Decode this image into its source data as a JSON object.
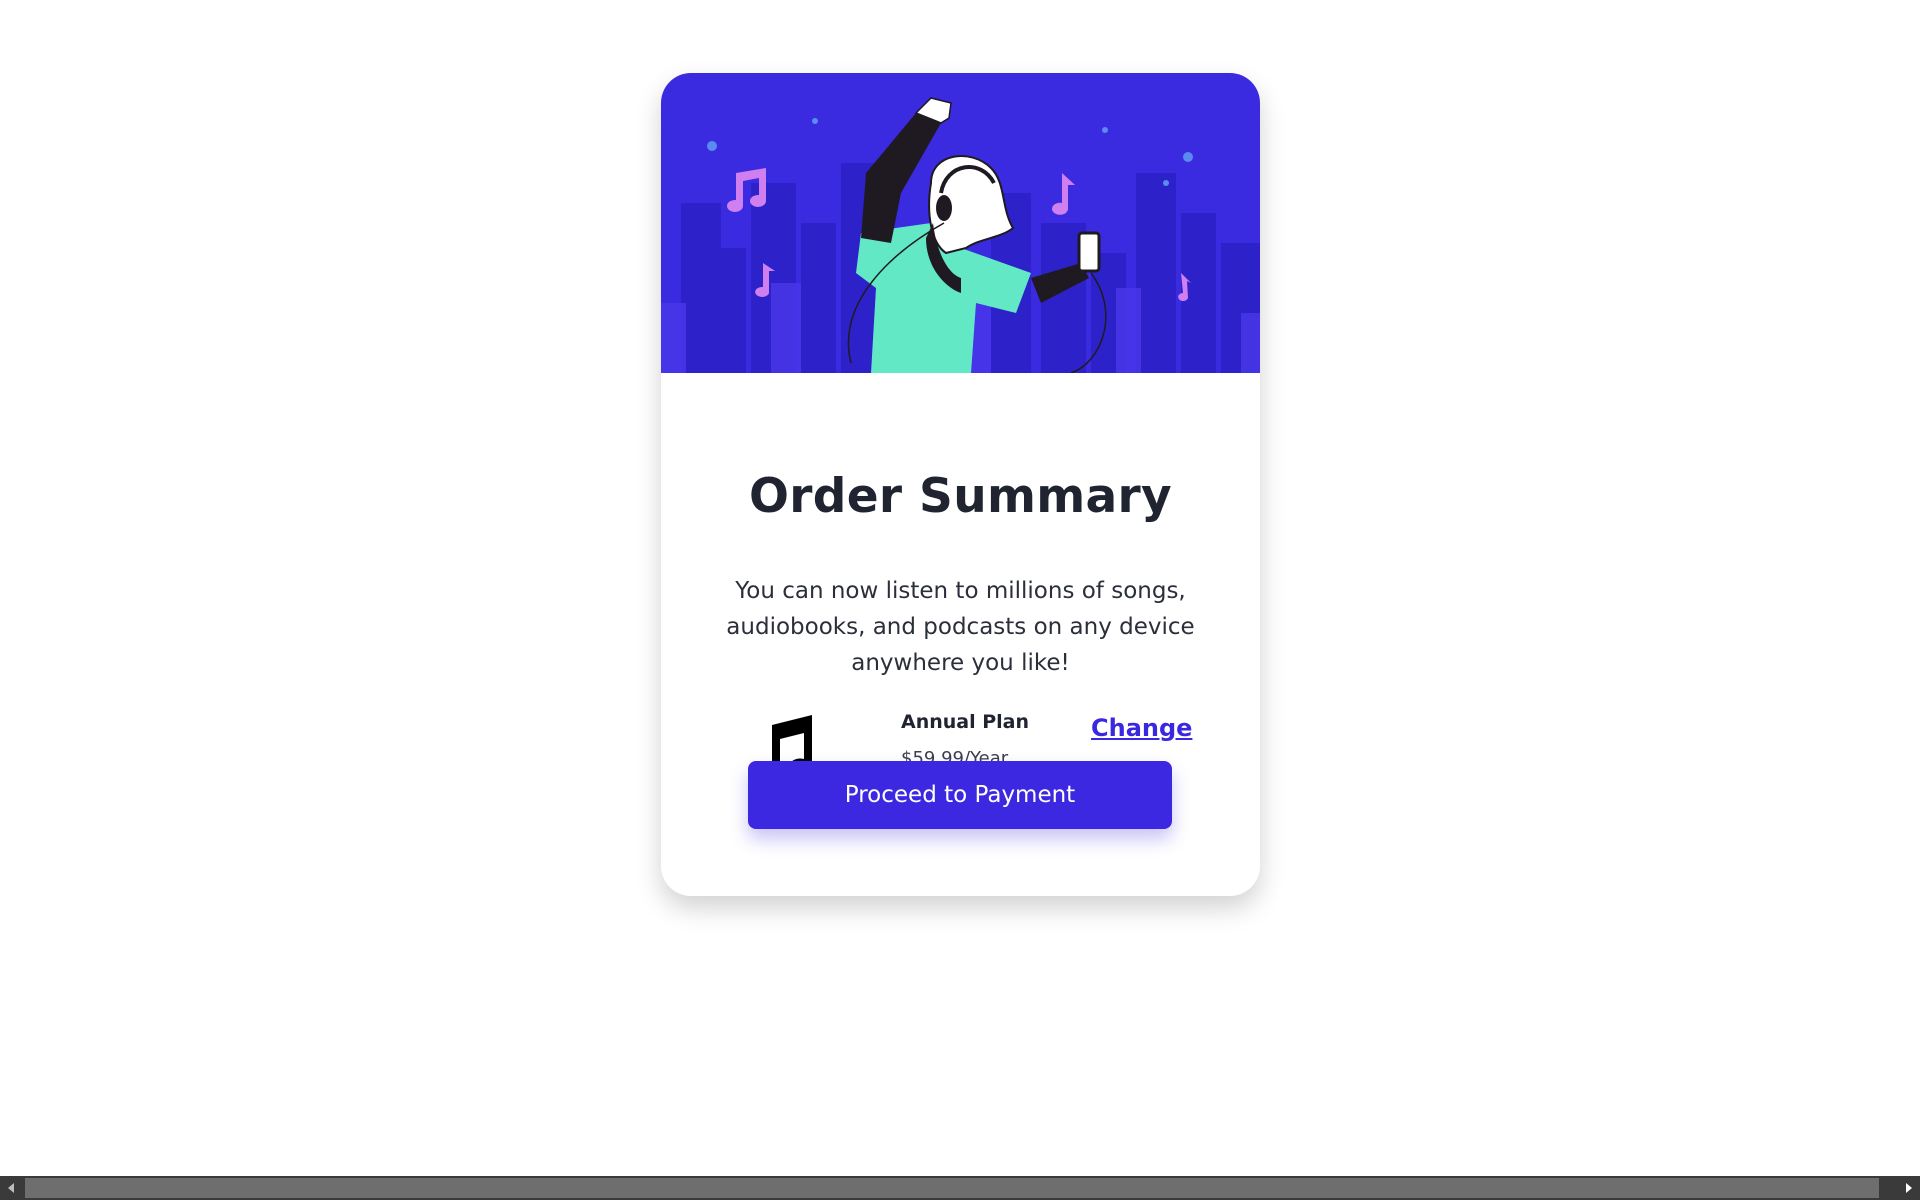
{
  "card": {
    "title": "Order Summary",
    "description": "You can now listen to millions of songs, audiobooks, and podcasts on any device anywhere you like!",
    "plan": {
      "icon": "music-note-icon",
      "name": "Annual Plan",
      "price": "$59.99/Year",
      "change_label": "Change"
    },
    "proceed_label": "Proceed to Payment"
  },
  "colors": {
    "accent": "#3b28e0",
    "hero_background": "#3a2ae0",
    "title_text": "#1f2430"
  },
  "scrollbar": {
    "left_arrow_icon": "chevron-left-icon",
    "right_arrow_icon": "chevron-right-icon"
  }
}
